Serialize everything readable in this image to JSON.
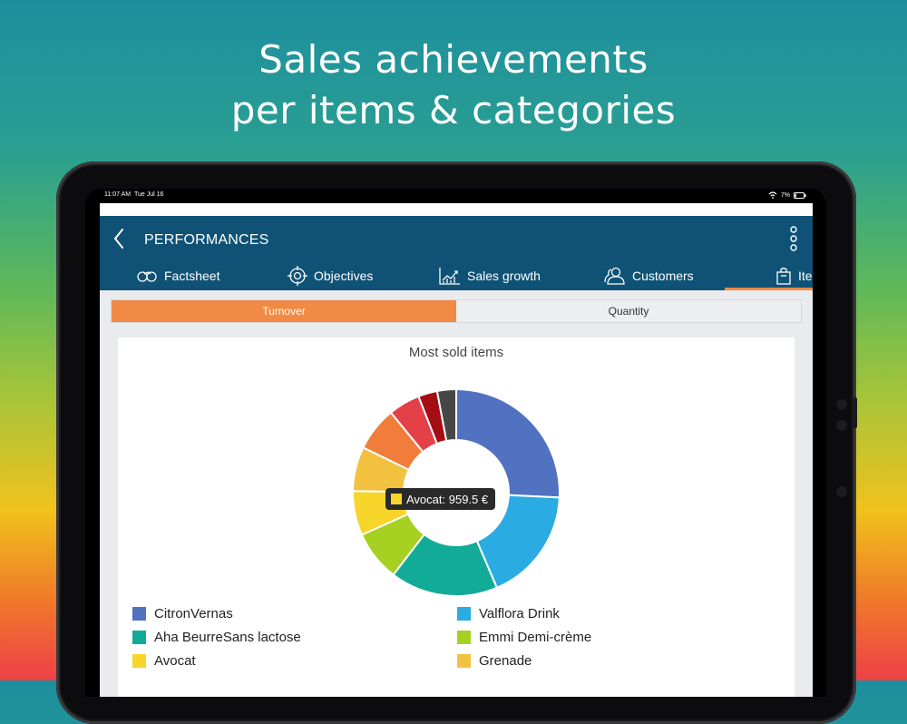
{
  "headline": {
    "line1": "Sales achievements",
    "line2": "per items & categories"
  },
  "statusbar": {
    "time": "11:07 AM",
    "date": "Tue Jul 16",
    "battery": "7%"
  },
  "appbar": {
    "title": "PERFORMANCES"
  },
  "tabs": [
    {
      "label": "Factsheet",
      "icon": "handshake-icon"
    },
    {
      "label": "Objectives",
      "icon": "target-icon"
    },
    {
      "label": "Sales growth",
      "icon": "growth-chart-icon"
    },
    {
      "label": "Customers",
      "icon": "users-icon"
    },
    {
      "label": "Ite",
      "icon": "shopping-bag-icon"
    }
  ],
  "segmented": {
    "options": [
      "Turnover",
      "Quantity"
    ],
    "selected": "Turnover"
  },
  "colors": {
    "accent": "#f08a44",
    "appbar": "#0f5276"
  },
  "chart_data": {
    "type": "pie",
    "title": "Most sold items",
    "hole": true,
    "slices": [
      {
        "label": "CitronVernas",
        "value": 26,
        "color": "#5172c0"
      },
      {
        "label": "Valflora Drink",
        "value": 18,
        "color": "#2aabe2"
      },
      {
        "label": "Aha BeurreSans lactose",
        "value": 17,
        "color": "#12ab98"
      },
      {
        "label": "Emmi Demi-crème",
        "value": 8,
        "color": "#a6d122"
      },
      {
        "label": "Avocat",
        "value": 7,
        "color": "#f7d52a"
      },
      {
        "label": "Grenade",
        "value": 7,
        "color": "#f3c140"
      },
      {
        "label": "",
        "value": 7,
        "color": "#f07d3a"
      },
      {
        "label": "",
        "value": 5,
        "color": "#e34048"
      },
      {
        "label": "",
        "value": 3,
        "color": "#a40d14"
      },
      {
        "label": "",
        "value": 3,
        "color": "#474747"
      }
    ],
    "tooltip": {
      "label": "Avocat: 959.5 €",
      "color": "#f7d52a"
    }
  }
}
